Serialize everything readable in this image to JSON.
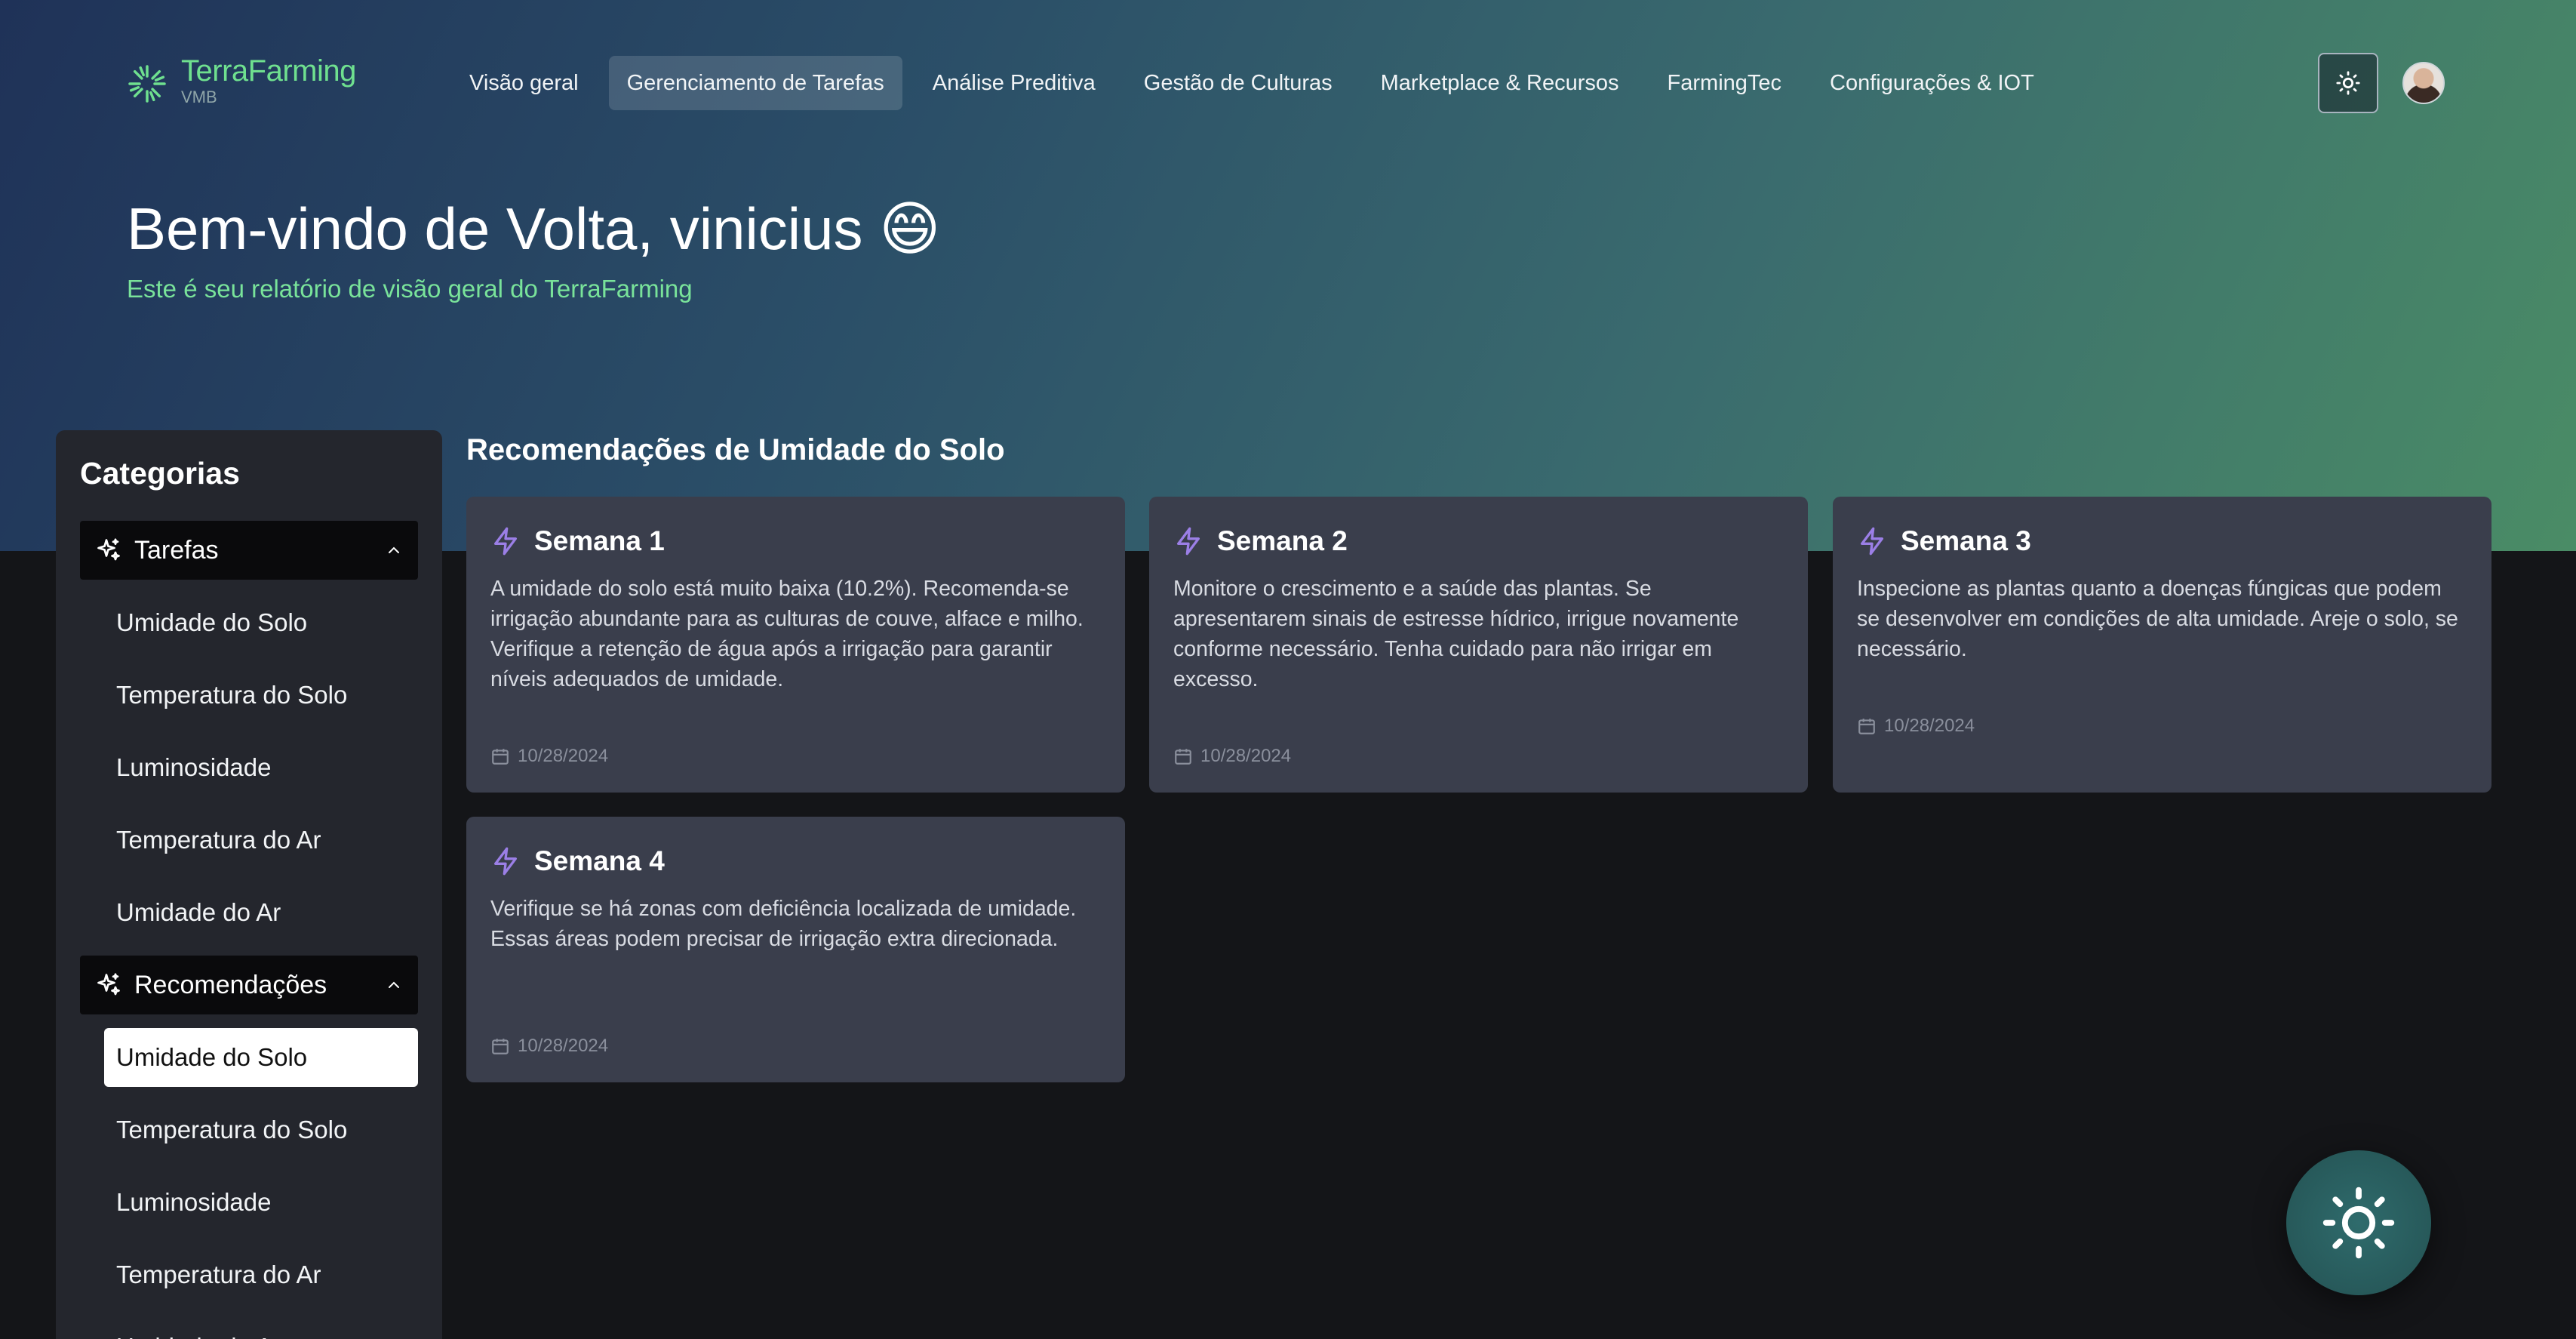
{
  "header": {
    "brand": "TerraFarming",
    "brand_sub": "VMB",
    "nav": [
      {
        "label": "Visão geral"
      },
      {
        "label": "Gerenciamento de Tarefas",
        "active": true
      },
      {
        "label": "Análise Preditiva"
      },
      {
        "label": "Gestão de Culturas"
      },
      {
        "label": "Marketplace & Recursos"
      },
      {
        "label": "FarmingTec"
      },
      {
        "label": "Configurações & IOT"
      }
    ],
    "theme_icon": "sun-icon",
    "avatar": "user-avatar"
  },
  "welcome": {
    "title": "Bem-vindo de Volta, vinicius 😄",
    "subtitle": "Este é seu relatório de visão geral do TerraFarming"
  },
  "sidebar": {
    "title": "Categorias",
    "groups": [
      {
        "label": "Tarefas",
        "icon": "sparkles-icon",
        "expanded": true,
        "items": [
          "Umidade do Solo",
          "Temperatura do Solo",
          "Luminosidade",
          "Temperatura do Ar",
          "Umidade do Ar"
        ]
      },
      {
        "label": "Recomendações",
        "icon": "sparkles-icon",
        "expanded": true,
        "items": [
          "Umidade do Solo",
          "Temperatura do Solo",
          "Luminosidade",
          "Temperatura do Ar",
          "Umidade do Ar"
        ],
        "selected": "Umidade do Solo"
      }
    ]
  },
  "main": {
    "title": "Recomendações de Umidade do Solo",
    "cards": [
      {
        "title": "Semana 1",
        "text": "A umidade do solo está muito baixa (10.2%). Recomenda-se irrigação abundante para as culturas de couve, alface e milho. Verifique a retenção de água após a irrigação para garantir níveis adequados de umidade.",
        "date": "10/28/2024"
      },
      {
        "title": "Semana 2",
        "text": "Monitore o crescimento e a saúde das plantas. Se apresentarem sinais de estresse hídrico, irrigue novamente conforme necessário. Tenha cuidado para não irrigar em excesso.",
        "date": "10/28/2024"
      },
      {
        "title": "Semana 3",
        "text": "Inspecione as plantas quanto a doenças fúngicas que podem se desenvolver em condições de alta umidade. Areje o solo, se necessário.",
        "date": "10/28/2024"
      },
      {
        "title": "Semana 4",
        "text": "Verifique se há zonas com deficiência localizada de umidade. Essas áreas podem precisar de irrigação extra direcionada.",
        "date": "10/28/2024"
      }
    ]
  },
  "fab": {
    "icon": "sun-icon"
  },
  "colors": {
    "accent": "#6fe08f",
    "card_bg": "#3a3e4c",
    "bolt": "#9b7fe6"
  }
}
